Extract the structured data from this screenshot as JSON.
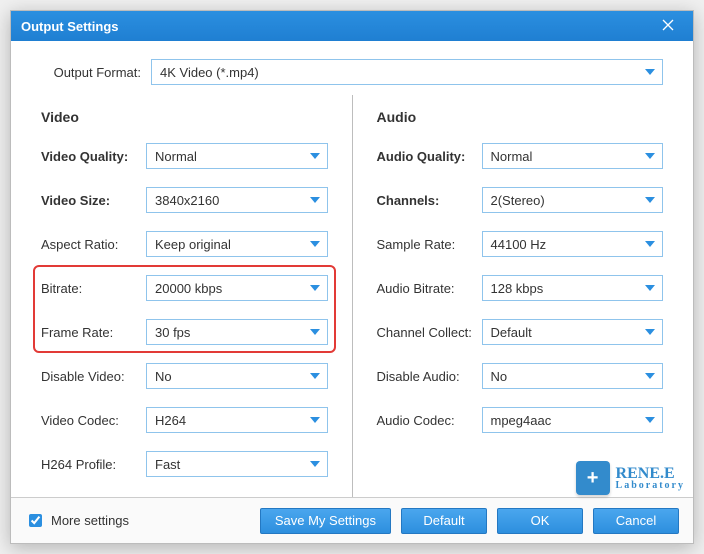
{
  "title": "Output Settings",
  "formatRow": {
    "label": "Output Format:",
    "value": "4K Video (*.mp4)"
  },
  "video": {
    "heading": "Video",
    "fields": [
      {
        "key": "video-quality",
        "label": "Video Quality:",
        "value": "Normal",
        "bold": true
      },
      {
        "key": "video-size",
        "label": "Video Size:",
        "value": "3840x2160",
        "bold": true
      },
      {
        "key": "aspect-ratio",
        "label": "Aspect Ratio:",
        "value": "Keep original",
        "bold": false
      },
      {
        "key": "bitrate",
        "label": "Bitrate:",
        "value": "20000 kbps",
        "bold": false
      },
      {
        "key": "frame-rate",
        "label": "Frame Rate:",
        "value": "30 fps",
        "bold": false
      },
      {
        "key": "disable-video",
        "label": "Disable Video:",
        "value": "No",
        "bold": false
      },
      {
        "key": "video-codec",
        "label": "Video Codec:",
        "value": "H264",
        "bold": false
      },
      {
        "key": "h264-profile",
        "label": "H264 Profile:",
        "value": "Fast",
        "bold": false
      }
    ]
  },
  "audio": {
    "heading": "Audio",
    "fields": [
      {
        "key": "audio-quality",
        "label": "Audio Quality:",
        "value": "Normal",
        "bold": true
      },
      {
        "key": "channels",
        "label": "Channels:",
        "value": "2(Stereo)",
        "bold": true
      },
      {
        "key": "sample-rate",
        "label": "Sample Rate:",
        "value": "44100 Hz",
        "bold": false
      },
      {
        "key": "audio-bitrate",
        "label": "Audio Bitrate:",
        "value": "128 kbps",
        "bold": false
      },
      {
        "key": "channel-collect",
        "label": "Channel Collect:",
        "value": "Default",
        "bold": false
      },
      {
        "key": "disable-audio",
        "label": "Disable Audio:",
        "value": "No",
        "bold": false
      },
      {
        "key": "audio-codec",
        "label": "Audio Codec:",
        "value": "mpeg4aac",
        "bold": false
      }
    ]
  },
  "footer": {
    "moreSettings": "More settings",
    "buttons": {
      "save": "Save My Settings",
      "default": "Default",
      "ok": "OK",
      "cancel": "Cancel"
    }
  },
  "watermark": {
    "line1": "RENE.E",
    "line2": "Laboratory"
  }
}
